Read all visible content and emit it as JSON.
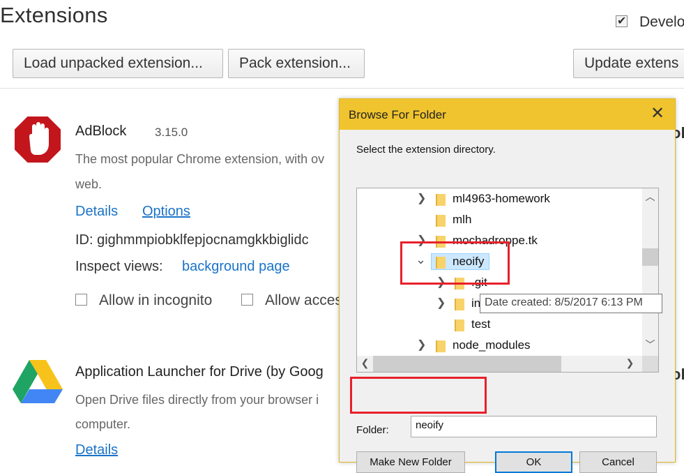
{
  "header": {
    "title": "Extensions",
    "developer_mode_label": "Develo",
    "developer_mode_checked": true,
    "buttons": {
      "load_unpacked": "Load unpacked extension...",
      "pack": "Pack extension...",
      "update": "Update extens"
    }
  },
  "extensions": [
    {
      "name": "AdBlock",
      "version": "3.15.0",
      "description_line1": "The most popular Chrome extension, with ov",
      "description_line2": "web.",
      "details_link": "Details",
      "options_link": "Options",
      "id_text": "ID: gighmmpiobklfepjocnamgkkbiglidc",
      "inspect_label": "Inspect views:",
      "inspect_link": "background page",
      "incognito_label": "Allow in incognito",
      "access_label": "Allow acces"
    },
    {
      "name": "Application Launcher for Drive (by Goog",
      "description_line1": "Open Drive files directly from your browser i",
      "description_line2": "computer.",
      "details_link": "Details"
    }
  ],
  "side_fragments": [
    "ole",
    "ole"
  ],
  "dialog": {
    "title": "Browse For Folder",
    "close_icon": "close-icon",
    "instruction": "Select the extension directory.",
    "tree": [
      {
        "label": "ml4963-homework",
        "expander": "collapsed"
      },
      {
        "label": "mlh",
        "expander": "none"
      },
      {
        "label": "mochadroppe.tk",
        "expander": "collapsed"
      },
      {
        "label": "neoify",
        "expander": "expanded",
        "selected": true
      },
      {
        "label": ".git",
        "expander": "collapsed"
      },
      {
        "label": "in",
        "expander": "collapsed"
      },
      {
        "label": "test",
        "expander": "none"
      },
      {
        "label": "node_modules",
        "expander": "collapsed"
      }
    ],
    "tooltip": "Date created: 8/5/2017 6:13 PM",
    "folder_label": "Folder:",
    "folder_value": "neoify",
    "buttons": {
      "new_folder": "Make New Folder",
      "ok": "OK",
      "cancel": "Cancel"
    }
  },
  "colors": {
    "dialog_title_bar": "#f0c42e",
    "link": "#1a73c8",
    "highlight_box": "#e8202a",
    "selection": "#cce8ff"
  }
}
